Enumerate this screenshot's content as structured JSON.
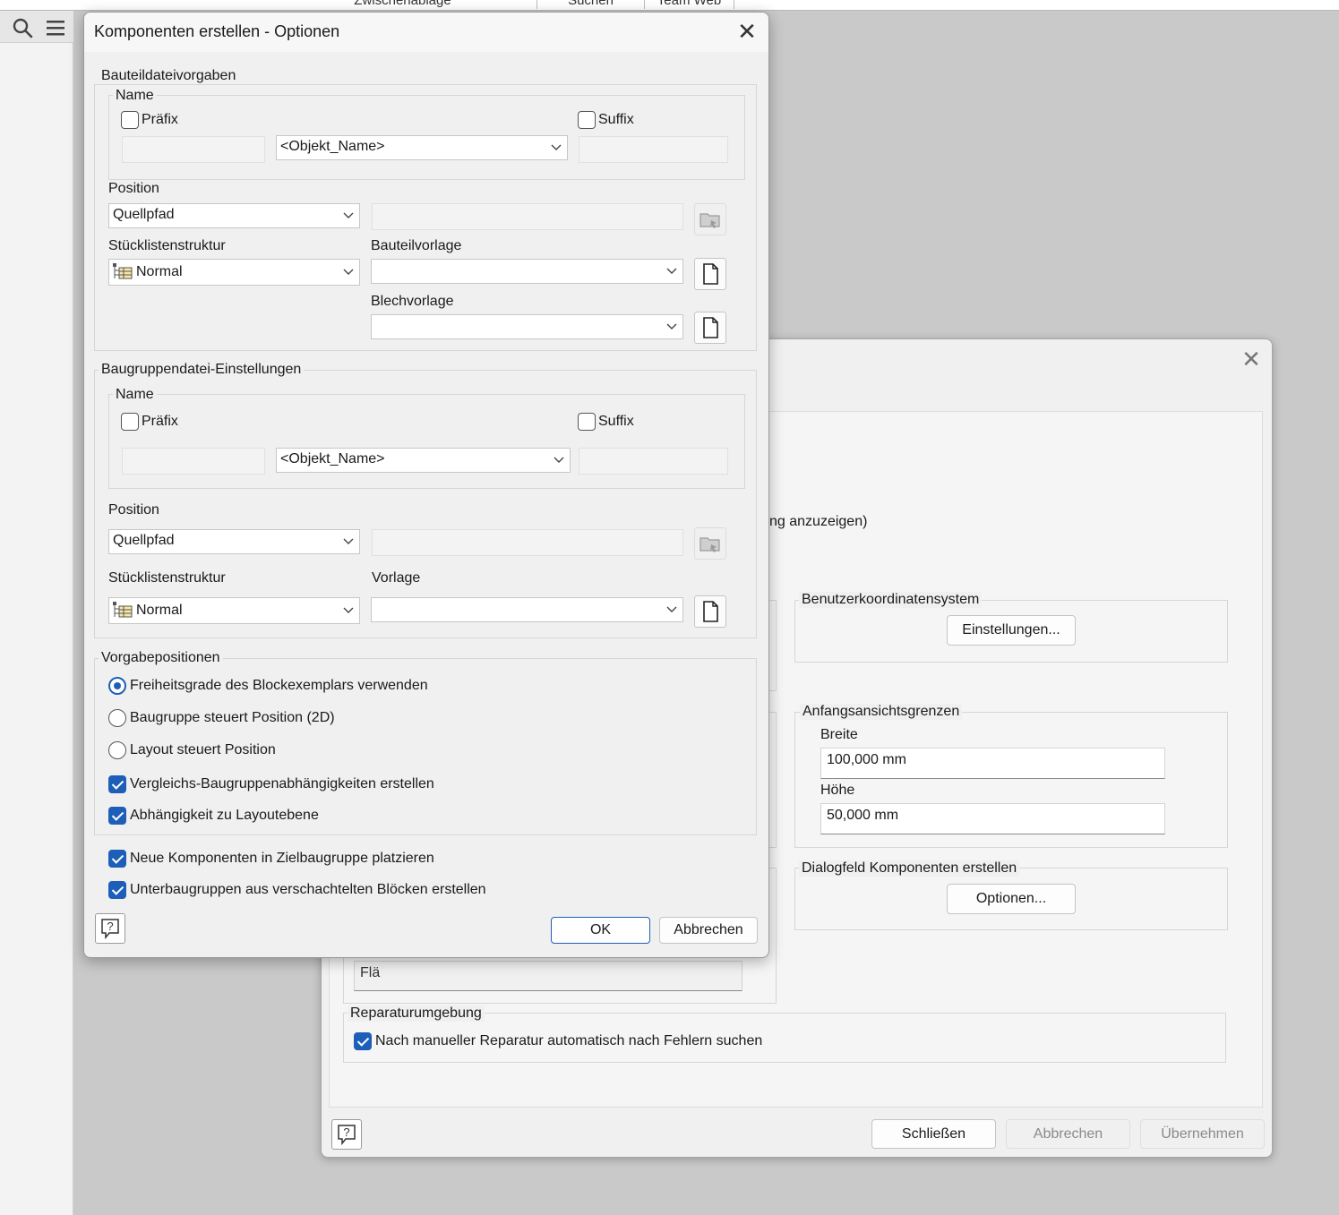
{
  "top_tabs": [
    "Zwischenablage",
    "Suchen",
    "Team Web"
  ],
  "icons": {
    "search": "search-icon",
    "menu": "hamburger-menu-icon",
    "close": "close-icon",
    "dropdown": "chevron-down-icon",
    "browse": "folder-browse-icon",
    "new_file": "new-document-icon",
    "help": "help-icon",
    "bom_structure": "bom-structure-icon"
  },
  "colors": {
    "accent": "#1d5fb8",
    "dialog_bg": "#f0f0f0",
    "backdrop": "#c9c9c9"
  },
  "front_dialog": {
    "title": "Komponenten erstellen - Optionen",
    "part_defaults": {
      "label": "Bauteildateivorgaben",
      "name_label": "Name",
      "prefix_label": "Präfix",
      "prefix_checked": false,
      "suffix_label": "Suffix",
      "suffix_checked": false,
      "name_combo": "<Objekt_Name>",
      "position_label": "Position",
      "position_combo": "Quellpfad",
      "bom_label": "Stücklistenstruktur",
      "bom_combo": "Normal",
      "template_label": "Bauteilvorlage",
      "template_combo": "",
      "sheetmetal_label": "Blechvorlage",
      "sheetmetal_combo": ""
    },
    "assembly_settings": {
      "label": "Baugruppendatei-Einstellungen",
      "name_label": "Name",
      "prefix_label": "Präfix",
      "prefix_checked": false,
      "suffix_label": "Suffix",
      "suffix_checked": false,
      "name_combo": "<Objekt_Name>",
      "position_label": "Position",
      "position_combo": "Quellpfad",
      "bom_label": "Stücklistenstruktur",
      "bom_combo": "Normal",
      "template_label": "Vorlage",
      "template_combo": ""
    },
    "default_positions": {
      "label": "Vorgabepositionen",
      "radios": [
        {
          "label": "Freiheitsgrade des Blockexemplars verwenden",
          "checked": true
        },
        {
          "label": "Baugruppe steuert Position (2D)",
          "checked": false
        },
        {
          "label": "Layout steuert Position",
          "checked": false
        }
      ],
      "checks": [
        {
          "label": "Vergleichs-Baugruppenabhängigkeiten erstellen",
          "checked": true
        },
        {
          "label": "Abhängigkeit zu Layoutebene",
          "checked": true
        }
      ]
    },
    "bottom_checks": [
      {
        "label": "Neue Komponenten in Zielbaugruppe platzieren",
        "checked": true
      },
      {
        "label": "Unterbaugruppen aus verschachtelten Blöcken erstellen",
        "checked": true
      }
    ],
    "ok_label": "OK",
    "cancel_label": "Abbrechen"
  },
  "back_dialog": {
    "partial_text": "ng anzuzeigen)",
    "ucs": {
      "label": "Benutzerkoordinatensystem",
      "button": "Einstellungen..."
    },
    "view_limits": {
      "label": "Anfangsansichtsgrenzen",
      "width_label": "Breite",
      "width_value": "100,000 mm",
      "height_label": "Höhe",
      "height_value": "50,000 mm"
    },
    "create_components": {
      "label": "Dialogfeld Komponenten erstellen",
      "button": "Optionen..."
    },
    "partial_field": "Flä",
    "repair": {
      "label": "Reparaturumgebung",
      "check_label": "Nach manueller Reparatur automatisch nach Fehlern suchen",
      "checked": true
    },
    "close_label": "Schließen",
    "cancel_label": "Abbrechen",
    "apply_label": "Übernehmen"
  }
}
